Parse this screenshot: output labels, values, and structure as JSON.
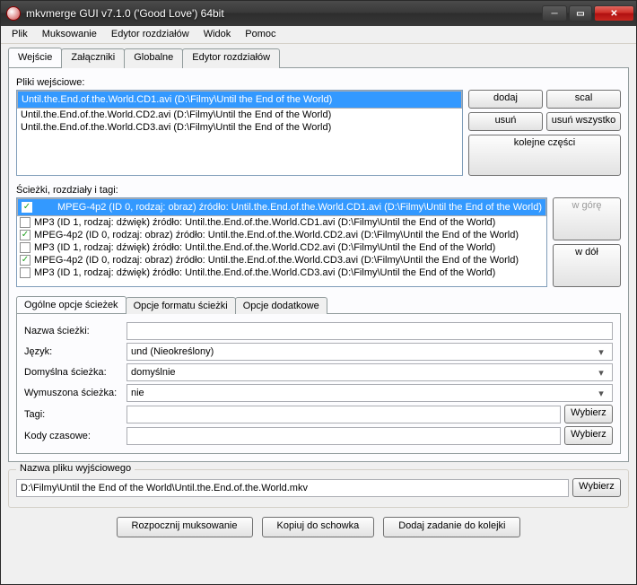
{
  "window": {
    "title": "mkvmerge GUI v7.1.0 ('Good Love') 64bit"
  },
  "menu": {
    "items": [
      "Plik",
      "Muksowanie",
      "Edytor rozdziałów",
      "Widok",
      "Pomoc"
    ]
  },
  "tabs": {
    "items": [
      "Wejście",
      "Załączniki",
      "Globalne",
      "Edytor rozdziałów"
    ],
    "active": 0
  },
  "input_files": {
    "label": "Pliki wejściowe:",
    "items": [
      "Until.the.End.of.the.World.CD1.avi (D:\\Filmy\\Until the End of the World)",
      "Until.the.End.of.the.World.CD2.avi (D:\\Filmy\\Until the End of the World)",
      "Until.the.End.of.the.World.CD3.avi (D:\\Filmy\\Until the End of the World)"
    ],
    "selected": 0,
    "buttons": {
      "add": "dodaj",
      "merge": "scal",
      "remove": "usuń",
      "remove_all": "usuń wszystko",
      "next_parts": "kolejne części"
    }
  },
  "tracks": {
    "label": "Ścieżki, rozdziały i tagi:",
    "items": [
      {
        "checked": true,
        "text": "MPEG-4p2 (ID 0, rodzaj: obraz) źródło: Until.the.End.of.the.World.CD1.avi (D:\\Filmy\\Until the End of the World)"
      },
      {
        "checked": false,
        "text": "MP3 (ID 1, rodzaj: dźwięk) źródło: Until.the.End.of.the.World.CD1.avi (D:\\Filmy\\Until the End of the World)"
      },
      {
        "checked": true,
        "text": "MPEG-4p2 (ID 0, rodzaj: obraz) źródło: Until.the.End.of.the.World.CD2.avi (D:\\Filmy\\Until the End of the World)"
      },
      {
        "checked": false,
        "text": "MP3 (ID 1, rodzaj: dźwięk) źródło: Until.the.End.of.the.World.CD2.avi (D:\\Filmy\\Until the End of the World)"
      },
      {
        "checked": true,
        "text": "MPEG-4p2 (ID 0, rodzaj: obraz) źródło: Until.the.End.of.the.World.CD3.avi (D:\\Filmy\\Until the End of the World)"
      },
      {
        "checked": false,
        "text": "MP3 (ID 1, rodzaj: dźwięk) źródło: Until.the.End.of.the.World.CD3.avi (D:\\Filmy\\Until the End of the World)"
      }
    ],
    "selected": 0,
    "buttons": {
      "up": "w górę",
      "down": "w dół"
    }
  },
  "subtabs": {
    "items": [
      "Ogólne opcje ścieżek",
      "Opcje formatu ścieżki",
      "Opcje dodatkowe"
    ],
    "active": 0
  },
  "options": {
    "name_label": "Nazwa ścieżki:",
    "name_value": "",
    "lang_label": "Język:",
    "lang_value": "und (Nieokreślony)",
    "default_label": "Domyślna ścieżka:",
    "default_value": "domyślnie",
    "forced_label": "Wymuszona ścieżka:",
    "forced_value": "nie",
    "tags_label": "Tagi:",
    "tags_value": "",
    "tc_label": "Kody czasowe:",
    "tc_value": "",
    "choose": "Wybierz"
  },
  "output": {
    "label": "Nazwa pliku wyjściowego",
    "value": "D:\\Filmy\\Until the End of the World\\Until.the.End.of.the.World.mkv",
    "choose": "Wybierz"
  },
  "bottom": {
    "start": "Rozpocznij muksowanie",
    "copy": "Kopiuj do schowka",
    "queue": "Dodaj zadanie do kolejki"
  }
}
